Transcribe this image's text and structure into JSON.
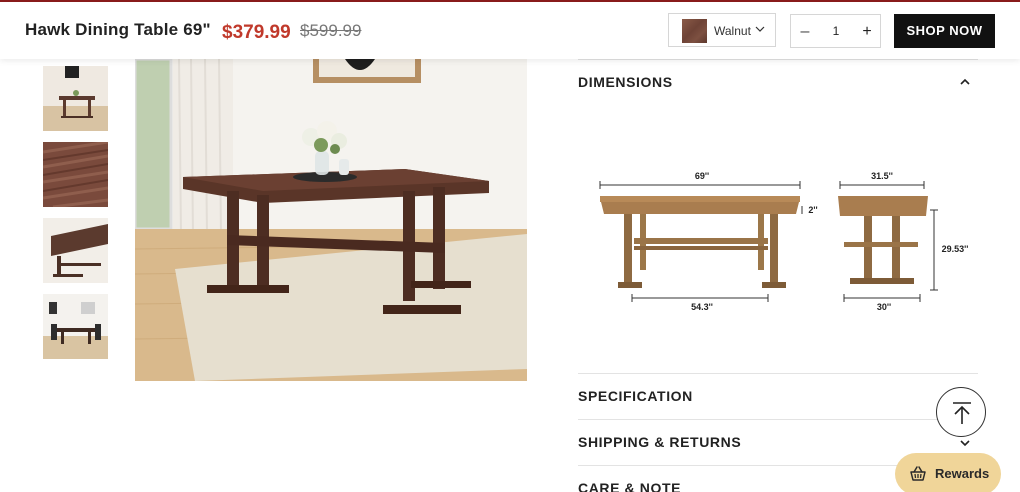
{
  "header": {
    "title": "Hawk Dining Table 69\"",
    "sale_price": "$379.99",
    "original_price": "$599.99",
    "variant": {
      "label": "Walnut",
      "icon": "chevron-down-icon"
    },
    "quantity": {
      "value": "1",
      "minus": "–",
      "plus": "+"
    },
    "cta": "SHOP NOW"
  },
  "accordion": {
    "dimensions": "DIMENSIONS",
    "specification": "SPECIFICATION",
    "shipping": "SHIPPING & RETURNS",
    "care": "CARE & NOTE"
  },
  "dimensions_diagram": {
    "length": "69''",
    "top_thickness": "2''",
    "base_length": "54.3''",
    "depth": "31.5''",
    "height": "29.53''",
    "base_depth": "30''"
  },
  "floating": {
    "rewards_label": "Rewards",
    "rewards_icon": "gift-basket-icon",
    "scroll_top_icon": "arrow-up-icon"
  },
  "colors": {
    "sale": "#c0392b",
    "button": "#111111",
    "rewards_bg": "#f0d599",
    "accent_line": "#8b1c1c"
  }
}
